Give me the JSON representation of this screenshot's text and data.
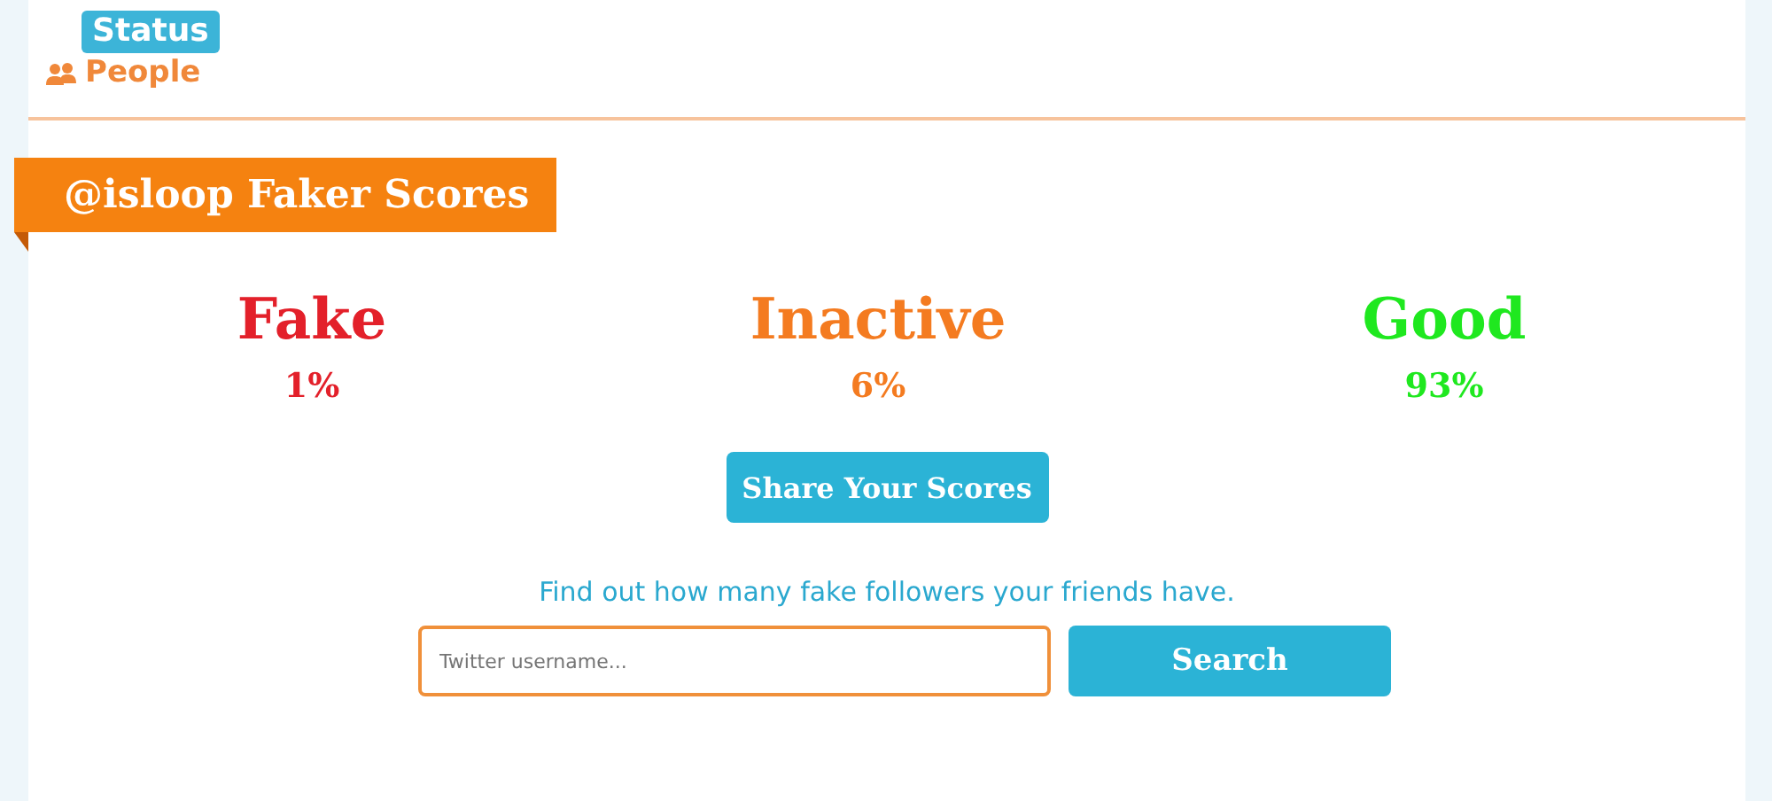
{
  "logo": {
    "top": "Status",
    "bottom": "People"
  },
  "banner": {
    "title": "@isloop Faker Scores"
  },
  "scores": [
    {
      "label": "Fake",
      "value": "1%",
      "color": "#e3202a"
    },
    {
      "label": "Inactive",
      "value": "6%",
      "color": "#f47b20"
    },
    {
      "label": "Good",
      "value": "93%",
      "color": "#1fe81f"
    }
  ],
  "share_button": "Share Your Scores",
  "prompt": "Find out how many fake followers your friends have.",
  "search": {
    "placeholder": "Twitter username...",
    "button": "Search"
  }
}
